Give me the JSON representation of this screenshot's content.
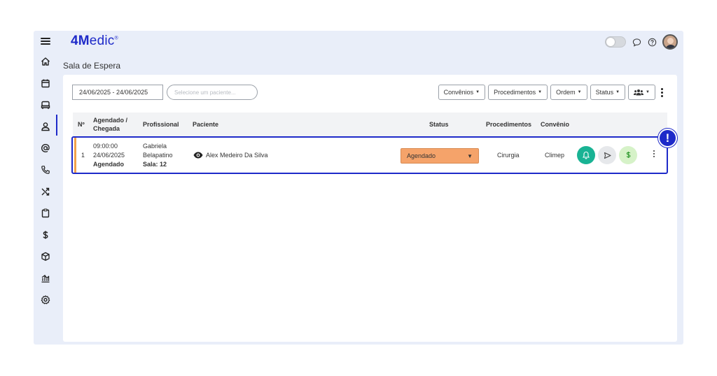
{
  "app": {
    "logo_bold": "4M",
    "logo_rest": "edic",
    "logo_mark": "®",
    "page_title": "Sala de Espera",
    "colors": {
      "brand": "#1e2ac9",
      "status_agendado": "#f5a36a",
      "bell": "#19b394",
      "money": "#d6f2c8"
    }
  },
  "topbar": {
    "icons": [
      "theme-toggle",
      "chat-icon",
      "help-icon",
      "user-avatar"
    ]
  },
  "sidebar": {
    "items": [
      {
        "name": "home-icon"
      },
      {
        "name": "calendar-icon"
      },
      {
        "name": "waiting-room-icon",
        "active": true
      },
      {
        "name": "user-icon"
      },
      {
        "name": "at-icon"
      },
      {
        "name": "phone-icon"
      },
      {
        "name": "shuffle-icon"
      },
      {
        "name": "clipboard-icon"
      },
      {
        "name": "dollar-icon"
      },
      {
        "name": "box-icon"
      },
      {
        "name": "chart-icon"
      },
      {
        "name": "settings-icon"
      }
    ]
  },
  "filters": {
    "date_range": "24/06/2025 - 24/06/2025",
    "patient_placeholder": "Selecione um paciente...",
    "buttons": [
      "Convênios",
      "Procedimentos",
      "Ordem",
      "Status"
    ]
  },
  "table": {
    "headers": {
      "num": "Nº",
      "scheduled_line1": "Agendado /",
      "scheduled_line2": "Chegada",
      "professional": "Profissional",
      "patient": "Paciente",
      "status": "Status",
      "procedures": "Procedimentos",
      "insurance": "Convênio"
    },
    "rows": [
      {
        "num": "1",
        "time": "09:00:00",
        "date": "24/06/2025",
        "state": "Agendado",
        "professional_first": "Gabriela",
        "professional_last": "Belapatino",
        "room": "Sala: 12",
        "patient": "Alex Medeiro Da Silva",
        "status": "Agendado",
        "procedure": "Cirurgia",
        "insurance": "Climep"
      }
    ]
  },
  "alert": {
    "symbol": "!"
  }
}
